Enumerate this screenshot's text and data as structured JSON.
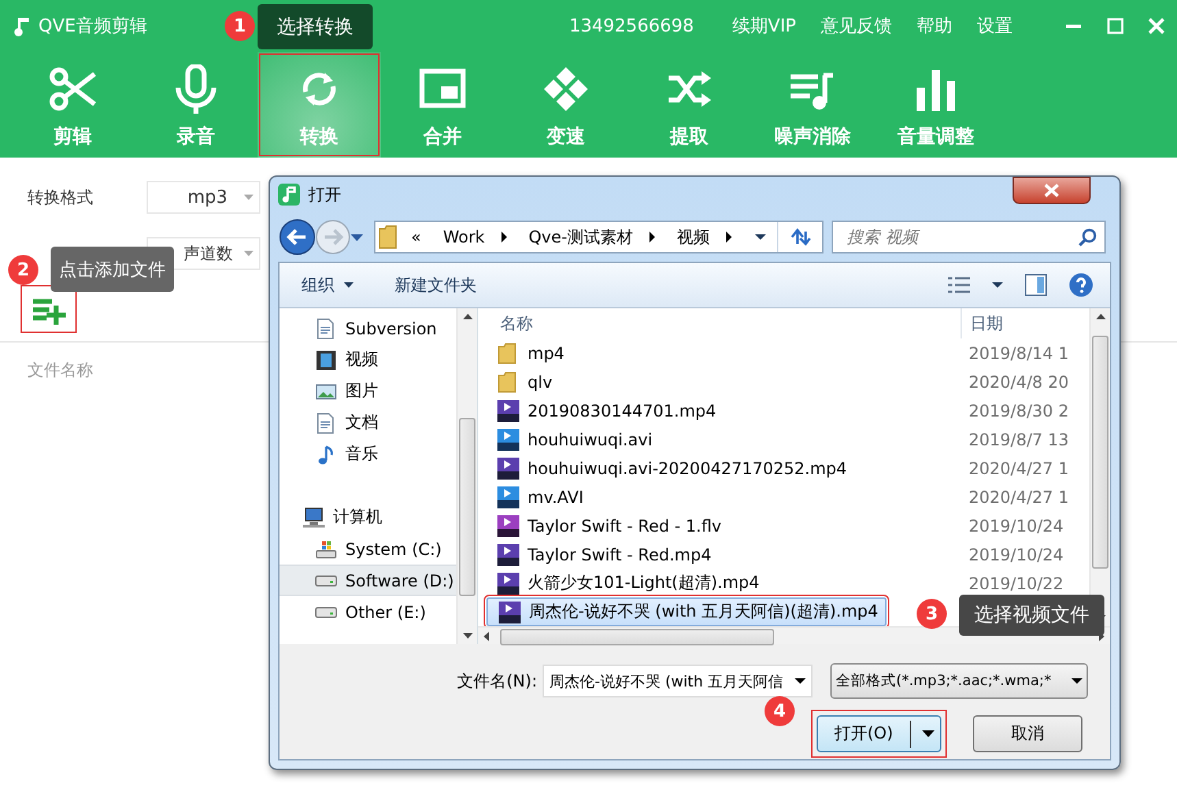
{
  "app": {
    "title": "QVE音频剪辑",
    "account": "13492566698",
    "links": [
      "续期VIP",
      "意见反馈",
      "帮助",
      "设置"
    ]
  },
  "tools": [
    {
      "label": "剪辑",
      "selected": false,
      "highlighted": false
    },
    {
      "label": "录音",
      "selected": false,
      "highlighted": false
    },
    {
      "label": "转换",
      "selected": true,
      "highlighted": true
    },
    {
      "label": "合并",
      "selected": false,
      "highlighted": false
    },
    {
      "label": "变速",
      "selected": false,
      "highlighted": false
    },
    {
      "label": "提取",
      "selected": false,
      "highlighted": false
    },
    {
      "label": "噪声消除",
      "selected": false,
      "highlighted": false
    },
    {
      "label": "音量调整",
      "selected": false,
      "highlighted": false
    }
  ],
  "settings": [
    {
      "label": "转换格式",
      "value": "mp3"
    },
    {
      "value": "声道数"
    }
  ],
  "add_button": {
    "highlighted": true
  },
  "file_list": {
    "column": "文件名称"
  },
  "dialog": {
    "title": "打开",
    "path_prefix": "«",
    "path": [
      "Work",
      "Qve-测试素材",
      "视频"
    ],
    "search": {
      "placeholder": "搜索 视频"
    },
    "toolbar": [
      {
        "label": "组织",
        "dropdown": true
      },
      {
        "label": "新建文件夹",
        "dropdown": false
      }
    ],
    "nav": [
      {
        "label": "Subversion",
        "selected": false
      },
      {
        "label": "视频",
        "selected": false
      },
      {
        "label": "图片",
        "selected": false
      },
      {
        "label": "文档",
        "selected": false
      },
      {
        "label": "音乐",
        "selected": false
      },
      {
        "label": "计算机",
        "selected": false,
        "children": [
          {
            "label": "System (C:)",
            "selected": false
          },
          {
            "label": "Software (D:)",
            "selected": true
          },
          {
            "label": "Other (E:)",
            "selected": false
          }
        ]
      }
    ],
    "columns": [
      "名称",
      "日期"
    ],
    "files": [
      {
        "name": "mp4",
        "kind": "folder",
        "date": "2019/8/14 1",
        "selected": false,
        "highlighted": false
      },
      {
        "name": "qlv",
        "kind": "folder",
        "date": "2020/4/8 20",
        "selected": false,
        "highlighted": false
      },
      {
        "name": "20190830144701.mp4",
        "kind": "mp4",
        "date": "2019/8/30 2",
        "selected": false,
        "highlighted": false
      },
      {
        "name": "houhuiwuqi.avi",
        "kind": "avi",
        "date": "2019/8/7 13",
        "selected": false,
        "highlighted": false
      },
      {
        "name": "houhuiwuqi.avi-20200427170252.mp4",
        "kind": "mp4",
        "date": "2020/4/27 1",
        "selected": false,
        "highlighted": false
      },
      {
        "name": "mv.AVI",
        "kind": "avi",
        "date": "2020/4/27 1",
        "selected": false,
        "highlighted": false
      },
      {
        "name": "Taylor Swift - Red - 1.flv",
        "kind": "flv",
        "date": "2019/10/24",
        "selected": false,
        "highlighted": false
      },
      {
        "name": "Taylor Swift - Red.mp4",
        "kind": "mp4",
        "date": "2019/10/24",
        "selected": false,
        "highlighted": false
      },
      {
        "name": "火箭少女101-Light(超清).mp4",
        "kind": "mp4",
        "date": "2019/10/22",
        "selected": false,
        "highlighted": false
      },
      {
        "name": "周杰伦-说好不哭 (with 五月天阿信)(超清).mp4",
        "kind": "mp4",
        "selected": true,
        "highlighted": true
      }
    ],
    "filename": {
      "label": "文件名(N):",
      "value": "周杰伦-说好不哭 (with 五月天阿信"
    },
    "filter": "全部格式(*.mp3;*.aac;*.wma;*",
    "buttons": [
      {
        "label": "打开(O)",
        "kind": "split",
        "highlighted": true
      },
      {
        "label": "取消",
        "kind": "plain",
        "highlighted": false
      }
    ]
  },
  "callouts": [
    {
      "number": "1",
      "text": "选择转换"
    },
    {
      "number": "2",
      "text": "点击添加文件"
    },
    {
      "number": "3",
      "text": "选择视频文件"
    },
    {
      "number": "4"
    }
  ]
}
